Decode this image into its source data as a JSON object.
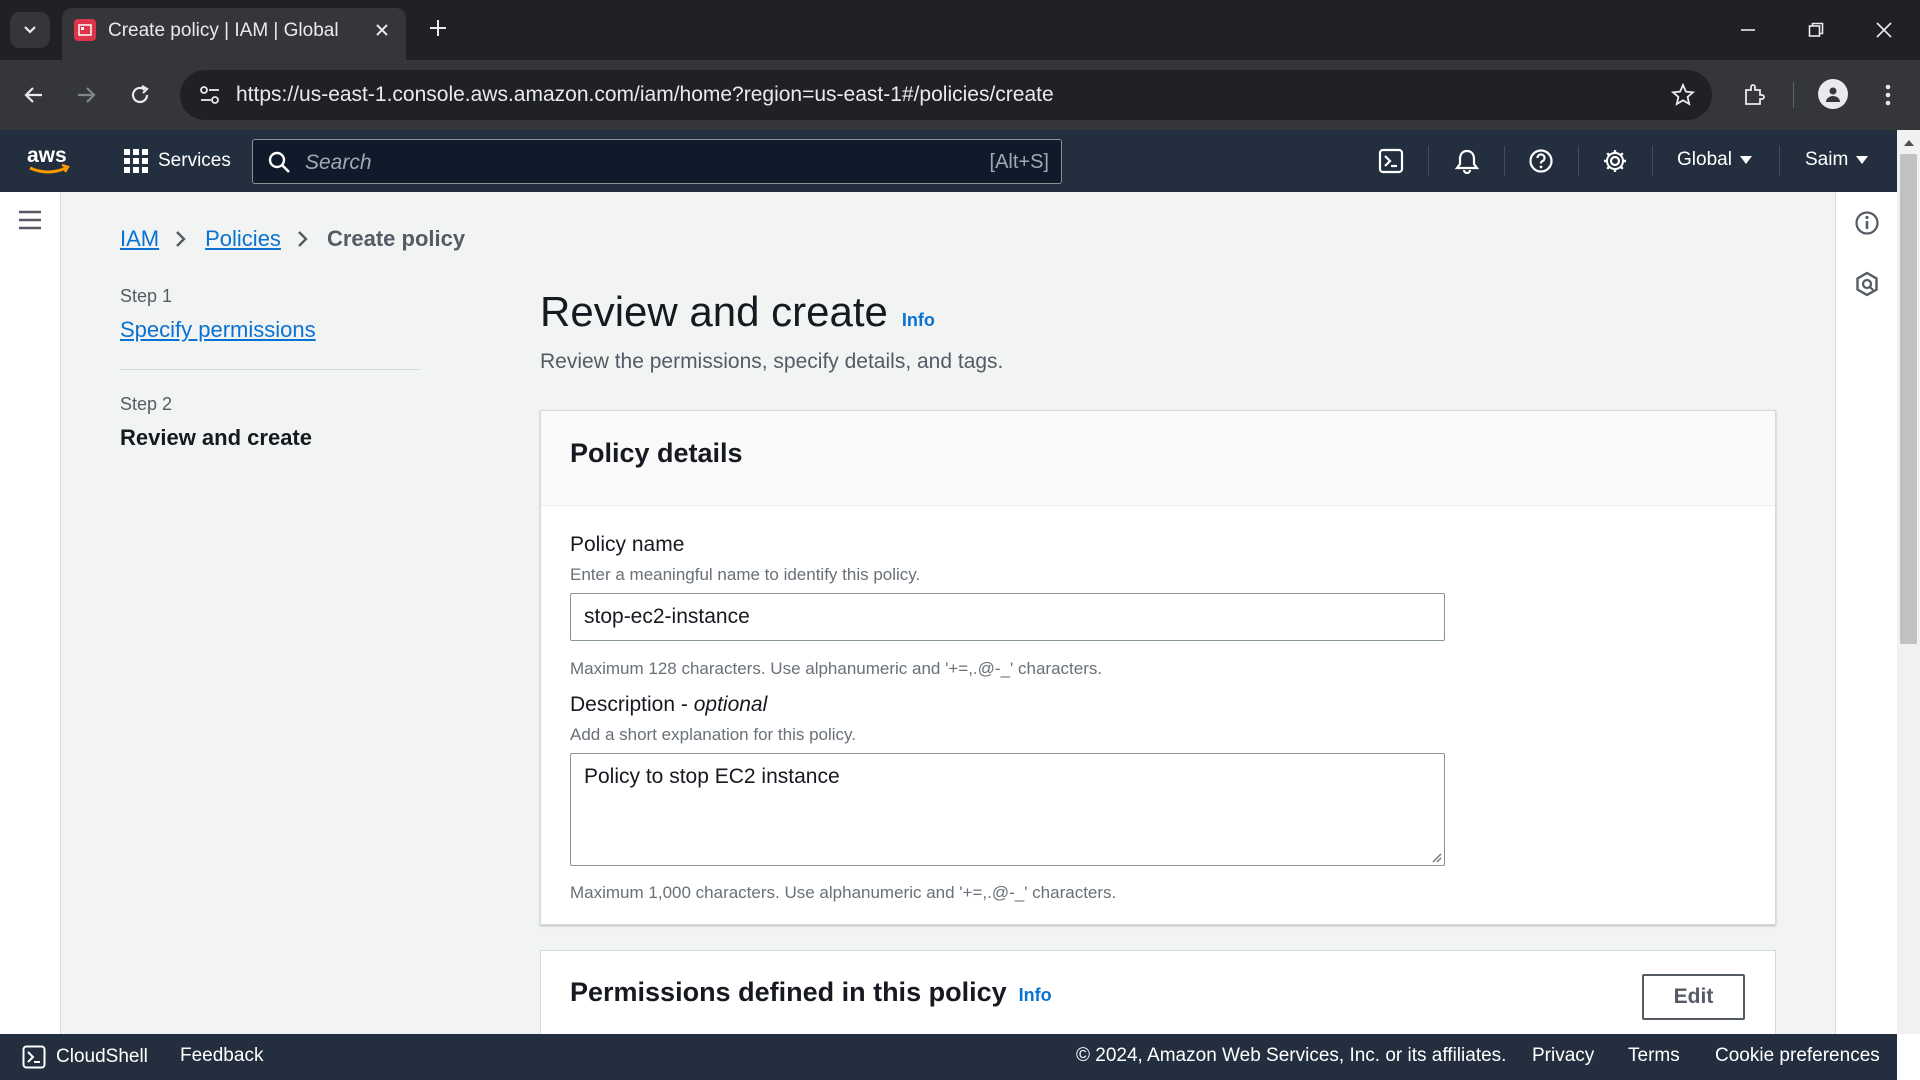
{
  "browser": {
    "tab_title": "Create policy | IAM | Global",
    "url": "https://us-east-1.console.aws.amazon.com/iam/home?region=us-east-1#/policies/create"
  },
  "header": {
    "services_label": "Services",
    "search_placeholder": "Search",
    "search_shortcut": "[Alt+S]",
    "region": "Global",
    "user": "Saim"
  },
  "breadcrumb": {
    "items": [
      "IAM",
      "Policies"
    ],
    "current": "Create policy"
  },
  "steps": [
    {
      "label": "Step 1",
      "title": "Specify permissions"
    },
    {
      "label": "Step 2",
      "title": "Review and create"
    }
  ],
  "page": {
    "title": "Review and create",
    "info": "Info",
    "description": "Review the permissions, specify details, and tags."
  },
  "policy_details": {
    "title": "Policy details",
    "name_label": "Policy name",
    "name_desc": "Enter a meaningful name to identify this policy.",
    "name_value": "stop-ec2-instance",
    "name_constraint": "Maximum 128 characters. Use alphanumeric and '+=,.@-_' characters.",
    "desc_label": "Description",
    "desc_optional": "optional",
    "desc_desc": "Add a short explanation for this policy.",
    "desc_value": "Policy to stop EC2 instance",
    "desc_constraint": "Maximum 1,000 characters. Use alphanumeric and '+=,.@-_' characters."
  },
  "permissions": {
    "title": "Permissions defined in this policy",
    "info": "Info",
    "edit_label": "Edit"
  },
  "footer": {
    "cloudshell": "CloudShell",
    "feedback": "Feedback",
    "copyright": "© 2024, Amazon Web Services, Inc. or its affiliates.",
    "privacy": "Privacy",
    "terms": "Terms",
    "cookies": "Cookie preferences"
  },
  "colors": {
    "aws_header": "#232f3e",
    "link": "#0972d3",
    "content_bg": "#f2f3f3"
  }
}
